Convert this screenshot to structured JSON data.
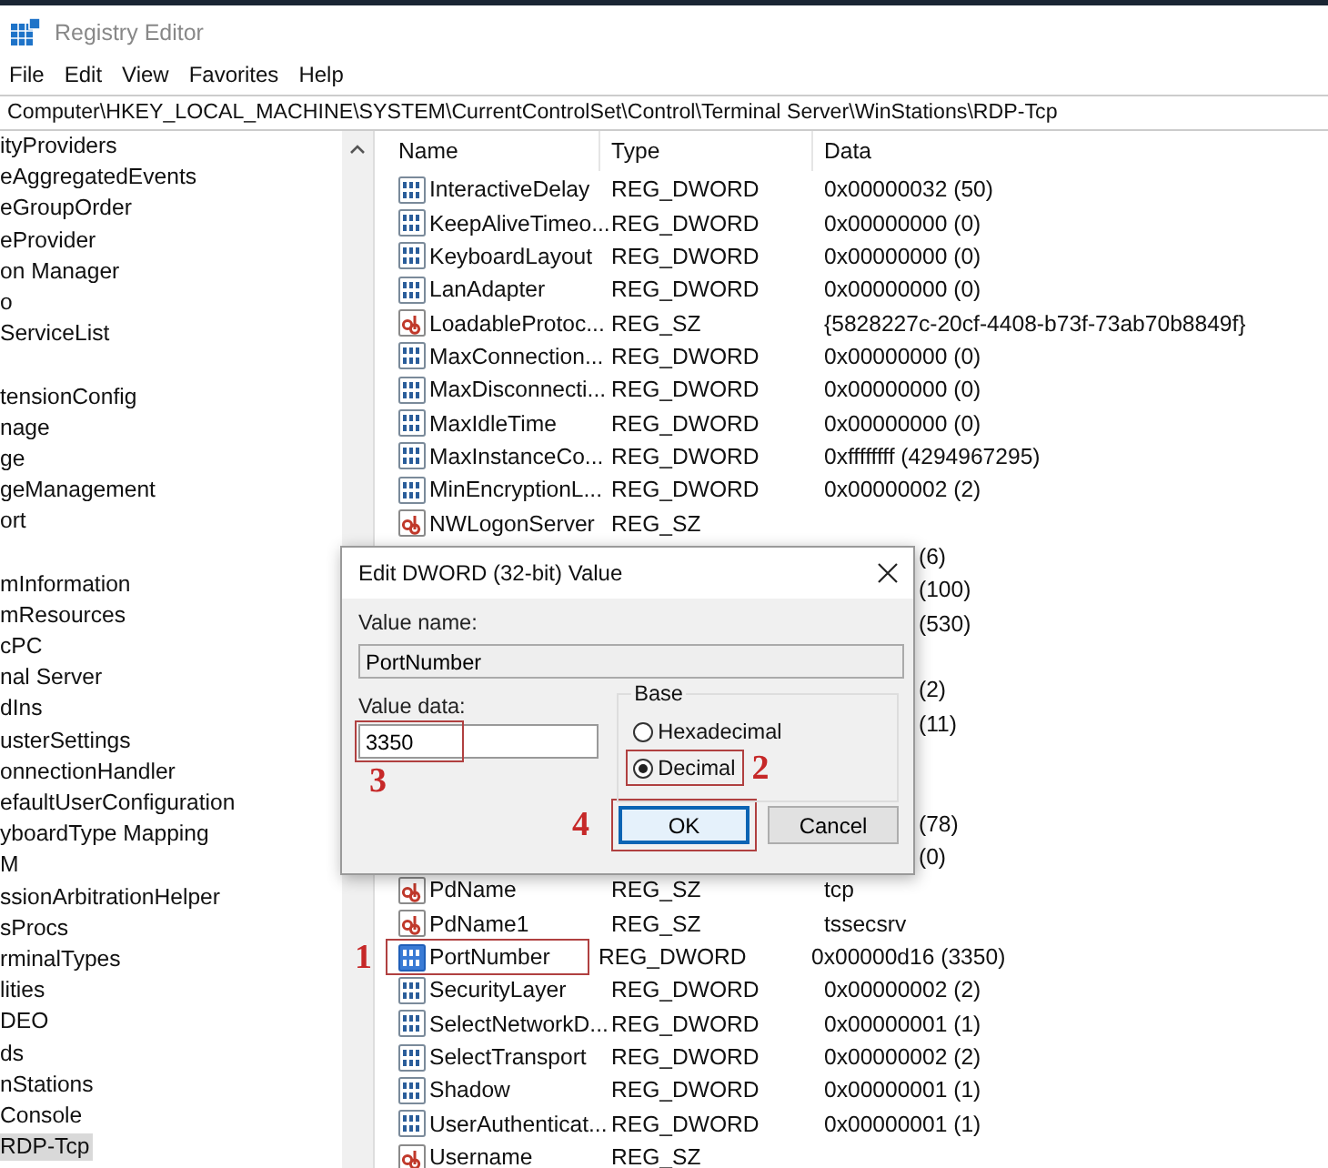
{
  "window": {
    "title": "Registry Editor"
  },
  "menu": [
    "File",
    "Edit",
    "View",
    "Favorites",
    "Help"
  ],
  "address": "Computer\\HKEY_LOCAL_MACHINE\\SYSTEM\\CurrentControlSet\\Control\\Terminal Server\\WinStations\\RDP-Tcp",
  "tree": [
    [
      {
        "label": "ityProviders",
        "selected": false
      },
      {
        "label": "eAggregatedEvents",
        "selected": false
      },
      {
        "label": "eGroupOrder",
        "selected": false
      },
      {
        "label": "eProvider",
        "selected": false
      },
      {
        "label": "on Manager",
        "selected": false
      },
      {
        "label": "o",
        "selected": false
      },
      {
        "label": "ServiceList",
        "selected": false
      }
    ],
    [
      {
        "label": "tensionConfig",
        "selected": false
      },
      {
        "label": "nage",
        "selected": false
      },
      {
        "label": "ge",
        "selected": false
      },
      {
        "label": "geManagement",
        "selected": false
      },
      {
        "label": "ort",
        "selected": false
      }
    ],
    [
      {
        "label": "mInformation",
        "selected": false
      },
      {
        "label": "mResources",
        "selected": false
      },
      {
        "label": "cPC",
        "selected": false
      },
      {
        "label": "nal Server",
        "selected": false
      },
      {
        "label": "dIns",
        "selected": false
      },
      {
        "label": "usterSettings",
        "selected": false
      },
      {
        "label": "onnectionHandler",
        "selected": false
      },
      {
        "label": "efaultUserConfiguration",
        "selected": false
      },
      {
        "label": "yboardType Mapping",
        "selected": false
      },
      {
        "label": "M",
        "selected": false
      },
      {
        "label": "ssionArbitrationHelper",
        "selected": false
      },
      {
        "label": "sProcs",
        "selected": false
      },
      {
        "label": "rminalTypes",
        "selected": false
      },
      {
        "label": "lities",
        "selected": false
      },
      {
        "label": "DEO",
        "selected": false
      },
      {
        "label": "ds",
        "selected": false
      },
      {
        "label": "nStations",
        "selected": false
      },
      {
        "label": " Console",
        "selected": false
      },
      {
        "label": "RDP-Tcp",
        "selected": true
      }
    ]
  ],
  "list": {
    "columns": [
      "Name",
      "Type",
      "Data"
    ],
    "rows": [
      {
        "kind": "dword",
        "name": "InteractiveDelay",
        "type": "REG_DWORD",
        "data": "0x00000032 (50)",
        "selected": false
      },
      {
        "kind": "dword",
        "name": "KeepAliveTimeo...",
        "type": "REG_DWORD",
        "data": "0x00000000 (0)",
        "selected": false
      },
      {
        "kind": "dword",
        "name": "KeyboardLayout",
        "type": "REG_DWORD",
        "data": "0x00000000 (0)",
        "selected": false
      },
      {
        "kind": "dword",
        "name": "LanAdapter",
        "type": "REG_DWORD",
        "data": "0x00000000 (0)",
        "selected": false
      },
      {
        "kind": "sz",
        "name": "LoadableProtoc...",
        "type": "REG_SZ",
        "data": "{5828227c-20cf-4408-b73f-73ab70b8849f}",
        "selected": false
      },
      {
        "kind": "dword",
        "name": "MaxConnection...",
        "type": "REG_DWORD",
        "data": "0x00000000 (0)",
        "selected": false
      },
      {
        "kind": "dword",
        "name": "MaxDisconnecti...",
        "type": "REG_DWORD",
        "data": "0x00000000 (0)",
        "selected": false
      },
      {
        "kind": "dword",
        "name": "MaxIdleTime",
        "type": "REG_DWORD",
        "data": "0x00000000 (0)",
        "selected": false
      },
      {
        "kind": "dword",
        "name": "MaxInstanceCo...",
        "type": "REG_DWORD",
        "data": "0xffffffff (4294967295)",
        "selected": false
      },
      {
        "kind": "dword",
        "name": "MinEncryptionL...",
        "type": "REG_DWORD",
        "data": "0x00000002 (2)",
        "selected": false
      },
      {
        "kind": "sz",
        "name": "NWLogonServer",
        "type": "REG_SZ",
        "selected": false
      },
      {
        "kind": "covered",
        "data": "(6)"
      },
      {
        "kind": "covered",
        "data": "(100)"
      },
      {
        "kind": "covered",
        "data": "(530)"
      },
      {
        "kind": "covered"
      },
      {
        "kind": "covered",
        "data": "(2)"
      },
      {
        "kind": "covered",
        "data": "(11)"
      },
      {
        "kind": "covered"
      },
      {
        "kind": "covered"
      },
      {
        "kind": "covered",
        "data": "(78)"
      },
      {
        "kind": "covered",
        "data": "(0)"
      },
      {
        "kind": "sz",
        "name": "PdName",
        "type": "REG_SZ",
        "data": "tcp",
        "selected": false
      },
      {
        "kind": "sz",
        "name": "PdName1",
        "type": "REG_SZ",
        "data": "tssecsrv",
        "selected": false
      },
      {
        "kind": "dword",
        "name": "PortNumber",
        "type": "REG_DWORD",
        "data": "0x00000d16 (3350)",
        "selected": true,
        "annotation": "1"
      },
      {
        "kind": "dword",
        "name": "SecurityLayer",
        "type": "REG_DWORD",
        "data": "0x00000002 (2)",
        "selected": false
      },
      {
        "kind": "dword",
        "name": "SelectNetworkD...",
        "type": "REG_DWORD",
        "data": "0x00000001 (1)",
        "selected": false
      },
      {
        "kind": "dword",
        "name": "SelectTransport",
        "type": "REG_DWORD",
        "data": "0x00000002 (2)",
        "selected": false
      },
      {
        "kind": "dword",
        "name": "Shadow",
        "type": "REG_DWORD",
        "data": "0x00000001 (1)",
        "selected": false
      },
      {
        "kind": "dword",
        "name": "UserAuthenticat...",
        "type": "REG_DWORD",
        "data": "0x00000001 (1)",
        "selected": false
      },
      {
        "kind": "sz",
        "name": "Username",
        "type": "REG_SZ",
        "selected": false
      }
    ]
  },
  "dialog": {
    "title": "Edit DWORD (32-bit) Value",
    "value_name_label": "Value name:",
    "value_name": "PortNumber",
    "value_data_label": "Value data:",
    "value_data": "3350",
    "value_data_annotation": "3",
    "base_label": "Base",
    "base_options": [
      {
        "label": "Hexadecimal",
        "selected": false
      },
      {
        "label": "Decimal",
        "selected": true,
        "annotation": "2"
      }
    ],
    "buttons": [
      {
        "label": "OK",
        "default": true,
        "annotation": "4"
      },
      {
        "label": "Cancel",
        "default": false
      }
    ]
  }
}
